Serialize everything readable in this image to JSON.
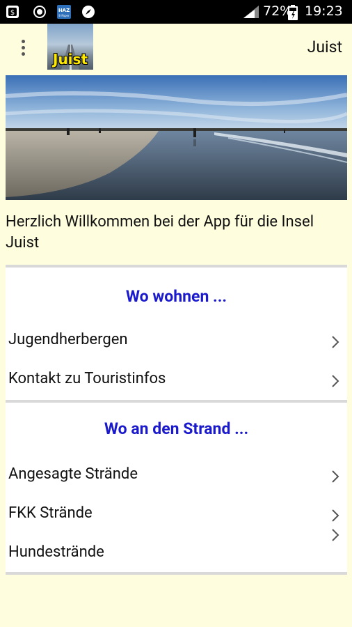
{
  "status_bar": {
    "battery": "72%",
    "time": "19:23"
  },
  "app_bar": {
    "logo_text": "Juist",
    "title": "Juist"
  },
  "welcome_text": "Herzlich Willkommen bei der App für die Insel Juist",
  "sections": [
    {
      "header": "Wo wohnen ...",
      "items": [
        {
          "label": "Jugendherbergen"
        },
        {
          "label": "Kontakt zu Touristinfos"
        }
      ]
    },
    {
      "header": "Wo an den Strand ...",
      "items": [
        {
          "label": "Angesagte Strände"
        },
        {
          "label": "FKK Strände"
        },
        {
          "label": "Hundestrände"
        }
      ]
    }
  ],
  "colors": {
    "background": "#fefdde",
    "section_header": "#1a1acc",
    "status_bar": "#000000"
  }
}
